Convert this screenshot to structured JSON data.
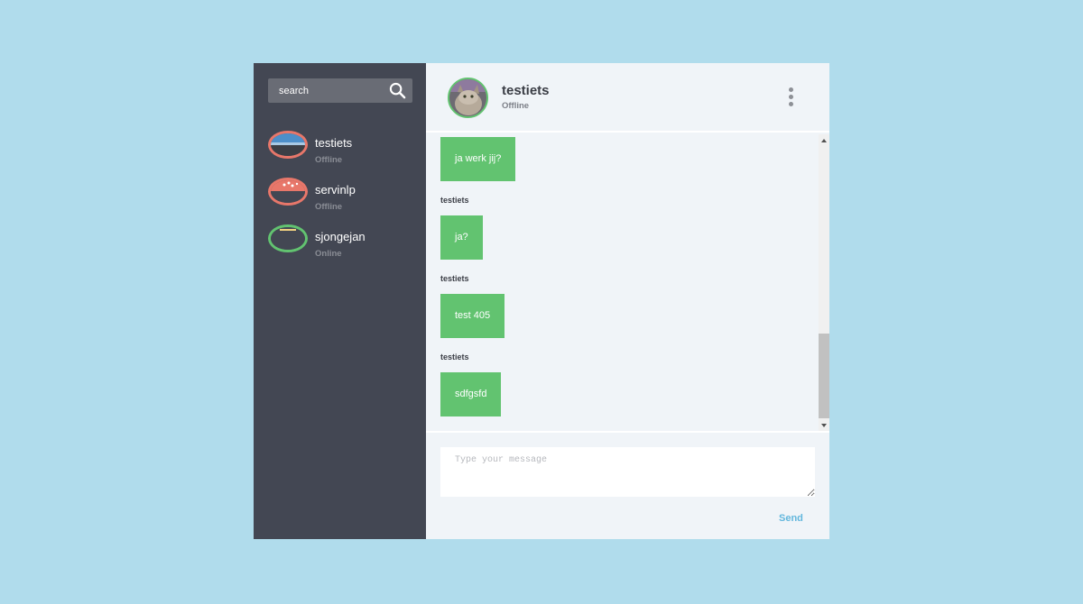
{
  "sidebar": {
    "search": {
      "placeholder": "search"
    },
    "contacts": [
      {
        "name": "testiets",
        "status": "Offline"
      },
      {
        "name": "servinlp",
        "status": "Offline"
      },
      {
        "name": "sjongejan",
        "status": "Online"
      }
    ]
  },
  "chat": {
    "header": {
      "name": "testiets",
      "status": "Offline"
    },
    "messages": [
      {
        "text": "ja werk jij?"
      },
      {
        "sender": "testiets",
        "text": "ja?"
      },
      {
        "sender": "testiets",
        "text": "test 405"
      },
      {
        "sender": "testiets",
        "text": "sdfgsfd"
      }
    ],
    "composer": {
      "placeholder": "Type your message",
      "send_label": "Send"
    }
  },
  "colors": {
    "background": "#b0dcec",
    "sidebar": "#434753",
    "bubble": "#62c370",
    "online": "#62c370",
    "offline": "#e8776a",
    "send": "#63b7dd"
  },
  "icons": [
    "search-icon",
    "more-vertical-icon",
    "scroll-up-icon",
    "scroll-down-icon"
  ]
}
